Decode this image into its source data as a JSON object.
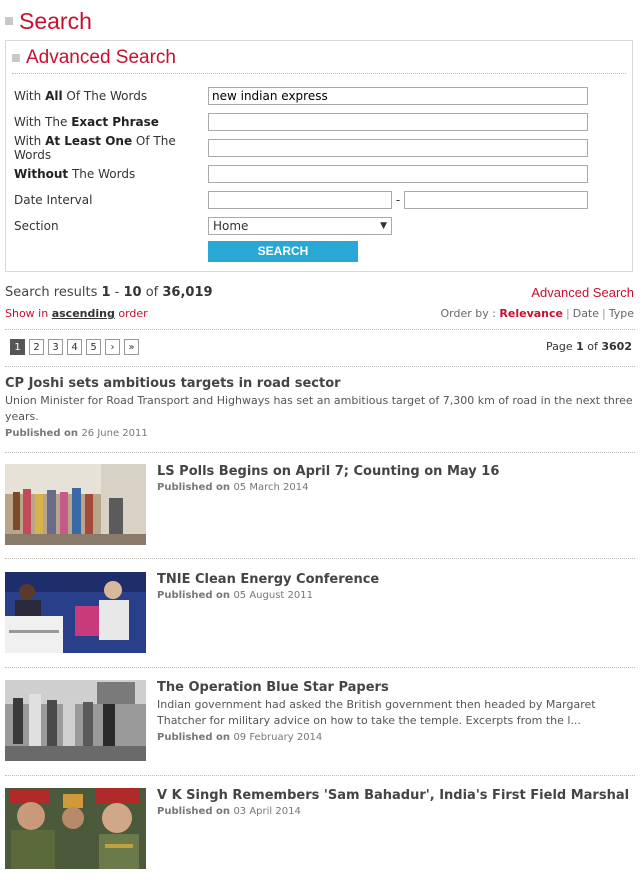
{
  "page": {
    "title": "Search"
  },
  "advanced": {
    "title": "Advanced Search",
    "fields": {
      "all_words": {
        "pre": "With ",
        "bold": "All",
        "post": " Of The Words",
        "value": "new indian express"
      },
      "exact_phrase": {
        "pre": "With The ",
        "bold": "Exact Phrase",
        "post": "",
        "value": ""
      },
      "at_least_one": {
        "pre": "With ",
        "bold": "At Least One",
        "post": " Of The Words",
        "value": ""
      },
      "without": {
        "pre": "",
        "bold": "Without",
        "post": " The Words",
        "value": ""
      },
      "date_interval": {
        "label": "Date Interval",
        "from": "",
        "to": "",
        "sep": "-"
      },
      "section": {
        "label": "Section",
        "value": "Home"
      }
    },
    "button": "SEARCH"
  },
  "results": {
    "prefix": "Search results ",
    "from": "1",
    "mid": " - ",
    "to": "10",
    "of": " of ",
    "total": "36,019",
    "advanced_link": "Advanced Search",
    "show_pre": "Show in ",
    "show_order": "ascending",
    "show_post": " order",
    "order_label": "Order by : ",
    "order_relevance": "Relevance",
    "order_date": "Date",
    "order_type": "Type",
    "separator": "|"
  },
  "pagination": {
    "pages": [
      "1",
      "2",
      "3",
      "4",
      "5"
    ],
    "next": "›",
    "last": "»",
    "info_pre": "Page ",
    "current": "1",
    "info_of": " of ",
    "total_pages": "3602"
  },
  "items": [
    {
      "title": "CP Joshi sets ambitious targets in road sector",
      "desc": "Union Minister for Road Transport and Highways has set an ambitious target of 7,300 km of road in the next three years.",
      "pub_label": "Published on ",
      "date": "26 June 2011"
    },
    {
      "title": "LS Polls Begins on April 7; Counting on May 16",
      "desc": "",
      "pub_label": "Published on ",
      "date": "05 March 2014"
    },
    {
      "title": "TNIE Clean Energy Conference",
      "desc": "",
      "pub_label": "Published on ",
      "date": "05 August 2011"
    },
    {
      "title": "The Operation Blue Star Papers",
      "desc": "Indian government had asked the British government then headed by Margaret Thatcher for military advice on how to take the temple. Excerpts from the l...",
      "pub_label": "Published on ",
      "date": "09 February 2014"
    },
    {
      "title": "V K Singh Remembers 'Sam Bahadur', India's First Field Marshal",
      "desc": "",
      "pub_label": "Published on ",
      "date": "03 April 2014"
    }
  ],
  "colors": {
    "brand": "#c8102e",
    "button": "#29a8d5"
  }
}
